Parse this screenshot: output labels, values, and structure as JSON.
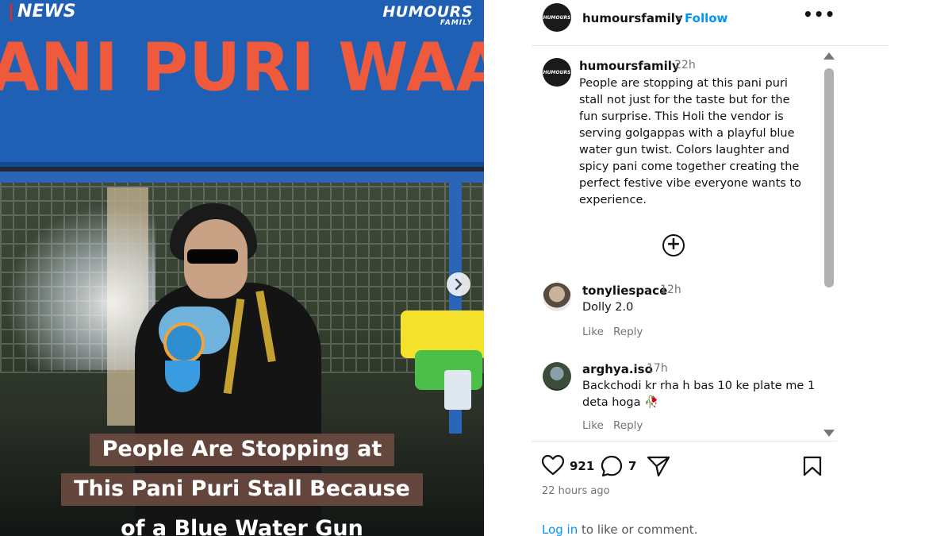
{
  "media": {
    "news_tag": "NEWS",
    "brand_big": "HUMOURS",
    "brand_small": "FAMILY",
    "sign_text": "ANI PURI WAALA",
    "caption_lines": [
      "People Are Stopping at",
      "This Pani Puri Stall Because",
      "of a Blue Water Gun"
    ],
    "next_icon": "chevron-right-icon"
  },
  "header": {
    "username": "humoursfamily",
    "separator": "•",
    "follow_label": "Follow",
    "more_label": "•••",
    "avatar_text": "HUMOURS"
  },
  "caption": {
    "username": "humoursfamily",
    "time": "22h",
    "text": "People are stopping at this pani puri stall not just for the taste but for the fun surprise. This Holi the vendor is serving golgappas with a playful blue water gun twist. Colors laughter and spicy pani come together creating the perfect festive vibe everyone wants to experience.",
    "more_icon": "plus-circle-icon"
  },
  "comments": [
    {
      "username": "tonyliespace",
      "time": "12h",
      "text": "Dolly 2.0",
      "like_label": "Like",
      "reply_label": "Reply"
    },
    {
      "username": "arghya.iso",
      "time": "17h",
      "text": "Backchodi kr rha h bas 10 ke plate me 1 deta hoga 🥀",
      "like_label": "Like",
      "reply_label": "Reply"
    }
  ],
  "actions": {
    "like_count": "921",
    "comment_count": "7",
    "posted": "22 hours ago",
    "login_link": "Log in",
    "login_rest": " to like or comment."
  },
  "colors": {
    "follow": "#0095f6",
    "sign_blue": "#1f5fb4",
    "sign_text": "#ef5a3c",
    "caption_bg": "#6a4a40"
  }
}
